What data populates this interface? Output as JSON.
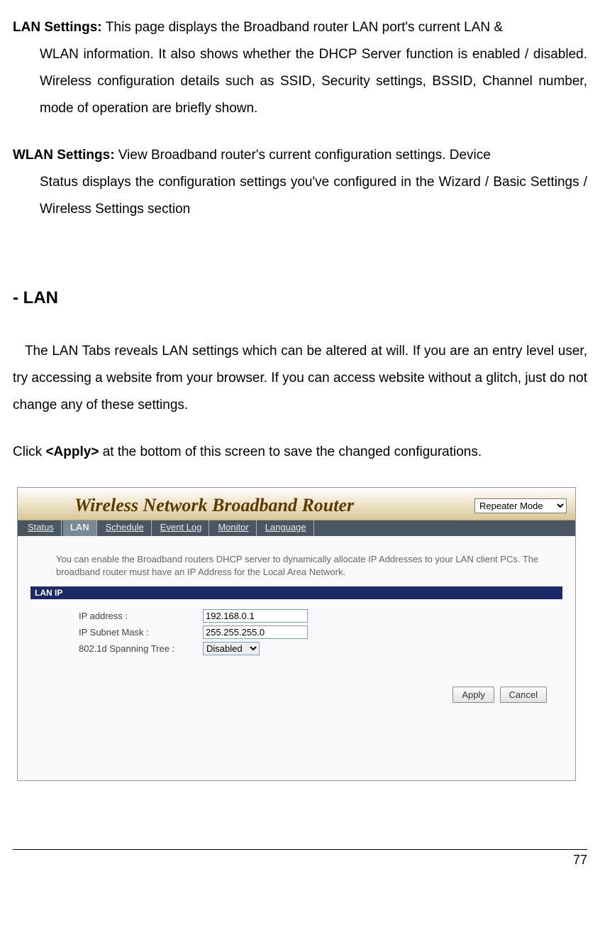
{
  "doc": {
    "lan_settings_label": "LAN Settings: ",
    "lan_settings_line1": "This page displays the Broadband router LAN port's current LAN &",
    "lan_settings_rest": "WLAN information. It also shows whether the DHCP Server function is enabled / disabled. Wireless configuration details such as SSID, Security settings, BSSID, Channel number, mode of operation are briefly shown.",
    "wlan_settings_label": "WLAN Settings: ",
    "wlan_settings_line1": "View Broadband router's current configuration settings. Device",
    "wlan_settings_rest": "Status displays the configuration settings you've configured in the Wizard / Basic Settings / Wireless Settings section",
    "lan_heading": "- LAN",
    "lan_intro": "   The LAN Tabs reveals LAN settings which can be altered at will. If you are an entry level user, try accessing a website from your browser. If you can access website without a glitch, just do not change any of these settings.",
    "click_pre": "Click ",
    "click_btn": "<Apply>",
    "click_post": " at the bottom of this screen to save the changed configurations.",
    "page_num": "77"
  },
  "router": {
    "title": "Wireless Network Broadband Router",
    "mode_option": "Repeater Mode",
    "nav": [
      "Status",
      "LAN",
      "Schedule",
      "Event Log",
      "Monitor",
      "Language"
    ],
    "desc": "You can enable the Broadband routers DHCP server to dynamically allocate IP Addresses to your LAN client PCs. The broadband router must have an IP Address for the Local Area Network.",
    "section": "LAN IP",
    "fields": {
      "ip_label": "IP address :",
      "ip_value": "192.168.0.1",
      "mask_label": "IP Subnet Mask :",
      "mask_value": "255.255.255.0",
      "stp_label": "802.1d Spanning Tree :",
      "stp_value": "Disabled"
    },
    "apply": "Apply",
    "cancel": "Cancel"
  }
}
